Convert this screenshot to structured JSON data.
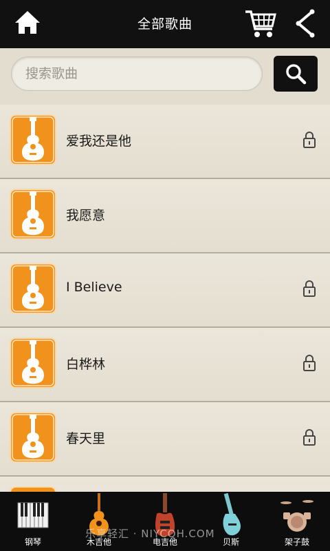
{
  "header": {
    "title": "全部歌曲",
    "home_icon": "home-icon",
    "cart_icon": "cart-icon",
    "back_icon": "share-back-icon"
  },
  "search": {
    "placeholder": "搜索歌曲",
    "button_icon": "search-icon"
  },
  "songs": [
    {
      "title": "爱我还是他",
      "locked": true
    },
    {
      "title": "我愿意",
      "locked": false
    },
    {
      "title": "I Believe",
      "locked": true
    },
    {
      "title": "白桦林",
      "locked": true
    },
    {
      "title": "春天里",
      "locked": true
    }
  ],
  "tabs": [
    {
      "label": "钢琴",
      "icon": "piano-icon"
    },
    {
      "label": "木吉他",
      "icon": "acoustic-guitar-icon"
    },
    {
      "label": "电吉他",
      "icon": "electric-guitar-icon"
    },
    {
      "label": "贝斯",
      "icon": "bass-icon"
    },
    {
      "label": "架子鼓",
      "icon": "drum-kit-icon"
    }
  ],
  "watermark": "乐享轻汇 · NIYCQH.COM",
  "colors": {
    "thumb_orange": "#f0921c",
    "topbar": "#111111",
    "background": "#e8e2d3"
  }
}
